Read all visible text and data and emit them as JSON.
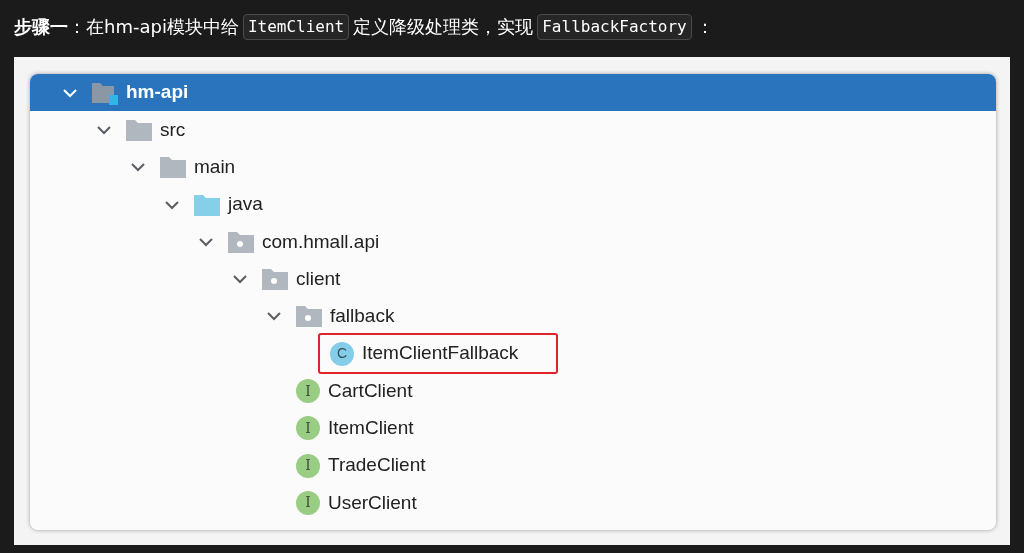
{
  "heading": [
    {
      "kind": "bold",
      "text": "步骤一"
    },
    {
      "kind": "text",
      "text": "：在hm-api模块中给"
    },
    {
      "kind": "code",
      "text": "ItemClient"
    },
    {
      "kind": "text",
      "text": "定义降级处理类，实现"
    },
    {
      "kind": "code",
      "text": "FallbackFactory"
    },
    {
      "kind": "text",
      "text": "："
    }
  ],
  "tree": [
    {
      "kind": "module",
      "label": "hm-api",
      "selected": true,
      "expanded": true,
      "highlighted": false,
      "children": [
        {
          "kind": "folder",
          "label": "src",
          "selected": false,
          "expanded": true,
          "highlighted": false,
          "children": [
            {
              "kind": "folder",
              "label": "main",
              "selected": false,
              "expanded": true,
              "highlighted": false,
              "children": [
                {
                  "kind": "source",
                  "label": "java",
                  "selected": false,
                  "expanded": true,
                  "highlighted": false,
                  "children": [
                    {
                      "kind": "package",
                      "label": "com.hmall.api",
                      "selected": false,
                      "expanded": true,
                      "highlighted": false,
                      "children": [
                        {
                          "kind": "package",
                          "label": "client",
                          "selected": false,
                          "expanded": true,
                          "highlighted": false,
                          "children": [
                            {
                              "kind": "package",
                              "label": "fallback",
                              "selected": false,
                              "expanded": true,
                              "highlighted": false,
                              "children": [
                                {
                                  "kind": "class",
                                  "badge": "C",
                                  "label": "ItemClientFallback",
                                  "selected": false,
                                  "highlighted": true
                                }
                              ]
                            },
                            {
                              "kind": "interface",
                              "badge": "I",
                              "label": "CartClient",
                              "selected": false,
                              "highlighted": false
                            },
                            {
                              "kind": "interface",
                              "badge": "I",
                              "label": "ItemClient",
                              "selected": false,
                              "highlighted": false
                            },
                            {
                              "kind": "interface",
                              "badge": "I",
                              "label": "TradeClient",
                              "selected": false,
                              "highlighted": false
                            },
                            {
                              "kind": "interface",
                              "badge": "I",
                              "label": "UserClient",
                              "selected": false,
                              "highlighted": false
                            }
                          ]
                        }
                      ]
                    }
                  ]
                }
              ]
            }
          ]
        }
      ]
    }
  ]
}
